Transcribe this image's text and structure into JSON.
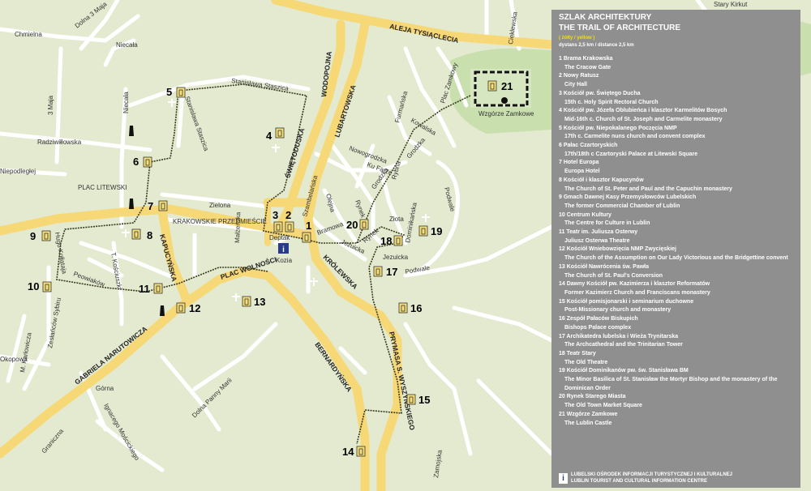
{
  "map": {
    "streets": {
      "aleja_tysiaclecia": "ALEJA TYSIĄCLECIA",
      "dolna_3_maja": "Dolna 3 Maja",
      "chmielna": "Chmielna",
      "niecala": "Niecała",
      "niecala_2": "Niecała",
      "ulica_3_maja": "3 Maja",
      "stanislawa_staszica": "Stanisława Staszica",
      "stanislawa_staszica_2": "Stanisława Staszica",
      "radziwillowska": "Radziwiłłowska",
      "niepodleglej": "Niepodległej",
      "plac_litewski": "PLAC LITEWSKI",
      "zielona": "Zielona",
      "krakowskie": "KRAKOWSKIE PRZEDMIEŚCIE",
      "hugo_kollataja": "Hugo Kołłątaja",
      "kapucynska": "KAPUCYŃSKA",
      "t_kosciuszki": "T. Kościuszki",
      "peowiakow": "Peowiaków",
      "zielinskiego_sybiru": "Zesłańców Sybiru",
      "m_karlowicza": "M. Karłowicza",
      "okopowa": "Okopowa",
      "gabriela_narutowicza": "GABRIELA NARUTOWICZA",
      "plac_wolnosci": "PLAC WOLNOŚCI",
      "bernardynska": "BERNARDYŃSKA",
      "gorna": "Górna",
      "dolna_panny_marii": "Dolna Panny Marii",
      "ignacego_moscickiego": "Ignacego Mościckiego",
      "graniczna": "Graniczna",
      "zamojska": "Zamojska",
      "prymasa": "PRYMASA S. WYSZYŃSKIEGO",
      "krolewska": "KRÓLEWSKA",
      "podwale": "Podwale",
      "podwale_2": "Podwale",
      "jezuicka": "Jezuicka",
      "jezuicka_2": "Jezuicka",
      "zlota": "Złota",
      "dominikanska": "Dominikańska",
      "rynek": "Rynek",
      "rynek_2": "Rynek",
      "bramowa": "Bramowa",
      "olejna": "Olejna",
      "swietoduska": "ŚWIĘTODUSKA",
      "lubartowska": "LUBARTOWSKA",
      "wodopojna": "WODOPOJNA",
      "nowogrodzka": "Nowogrodzka",
      "grodzka": "Grodzka",
      "grodzka_2": "Grodzka",
      "ku_farze": "Ku Farze",
      "rybna": "Rybna",
      "furmanska": "Furmańska",
      "plac_zamkowy": "Plac Zamkowy",
      "kowalska": "Kowalska",
      "cieklewska": "Cieklewska",
      "stary_kirkut": "Stary Kirkut",
      "deptak": "Deptak",
      "kozia": "Kozia",
      "samborska": "Sambrowska",
      "wzgorze": "Wzgórze Zamkowe",
      "malzonka": "Małżeńska",
      "szambelanska": "Szambelańska"
    },
    "stops": [
      "1",
      "2",
      "3",
      "4",
      "5",
      "6",
      "7",
      "8",
      "9",
      "10",
      "11",
      "12",
      "13",
      "14",
      "15",
      "16",
      "17",
      "18",
      "19",
      "20",
      "21"
    ],
    "info_glyph": "i",
    "colors": {
      "background": "#e3ead0",
      "major_road": "#f7d877",
      "minor_road": "#ffffff",
      "route": "#3a3a1a",
      "park": "#c9dfae",
      "panel": "#8f8f8f",
      "accent": "#f6e000"
    }
  },
  "legend": {
    "title": "SZLAK ARCHITEKTURY",
    "subtitle": "THE TRAIL OF ARCHITECTURE",
    "color_note": "( żółty / yellow )",
    "distance": "dystans 2,5 km / distance 2,5 km",
    "items": [
      {
        "num": "1",
        "pl": "Brama Krakowska",
        "en": "The Cracow Gate"
      },
      {
        "num": "2",
        "pl": "Nowy Ratusz",
        "en": "City Hall"
      },
      {
        "num": "3",
        "pl": "Kościół pw. Świętego Ducha",
        "en": "15th c. Holy Spirit Rectoral Church"
      },
      {
        "num": "4",
        "pl": "Kościół pw. Józefa Oblubieńca i klasztor Karmelitów Bosych",
        "en": "Mid-16th c. Church of St. Joseph and Carmelite monastery"
      },
      {
        "num": "5",
        "pl": "Kościół pw. Niepokalanego Poczęcia NMP",
        "en": "17th c. Carmelite nuns church and convent complex"
      },
      {
        "num": "6",
        "pl": "Pałac Czartoryskich",
        "en": "17th/18th c Czartoryski Palace at Litewski Square"
      },
      {
        "num": "7",
        "pl": "Hotel Europa",
        "en": "Europa Hotel"
      },
      {
        "num": "8",
        "pl": "Kościół i klasztor Kapucynów",
        "en": "The Church of St. Peter and Paul and the Capuchin monastery"
      },
      {
        "num": "9",
        "pl": "Gmach Dawnej Kasy Przemysłowców Lubelskich",
        "en": "The former Commercial Chamber of Lublin"
      },
      {
        "num": "10",
        "pl": "Centrum Kultury",
        "en": "The Centre for Culture in Lublin"
      },
      {
        "num": "11",
        "pl": "Teatr im. Juliusza Osterwy",
        "en": "Juliusz Osterwa Theatre"
      },
      {
        "num": "12",
        "pl": "Kościół Wniebowzięcia NMP Zwycięskiej",
        "en": "The Church of the Assumption on Our Lady Victorious and the Bridgettine convent"
      },
      {
        "num": "13",
        "pl": "Kościół Nawrócenia św. Pawła",
        "en": "The Church of St. Paul's Conversion"
      },
      {
        "num": "14",
        "pl": "Dawny Kościół pw. Kazimierza i klasztor Reformatów",
        "en": "Former Kazimierz Church and Franciscans monastery"
      },
      {
        "num": "15",
        "pl": "Kościół pomisjonarski i seminarium duchowne",
        "en": "Post-Missionary church and monastery"
      },
      {
        "num": "16",
        "pl": "Zespół Pałaców Biskupich",
        "en": "Bishops Palace complex"
      },
      {
        "num": "17",
        "pl": "Archikatedra lubelska i Wieża Trynitarska",
        "en": "The Archcathedral and the Trinitarian Tower"
      },
      {
        "num": "18",
        "pl": "Teatr Stary",
        "en": "The Old Theatre"
      },
      {
        "num": "19",
        "pl": "Kościół Dominikanów pw. św. Stanisława BM",
        "en": "The Minor Basilica of St. Stanisław the Mortyr Bishop and the monastery of the Dominican Order"
      },
      {
        "num": "20",
        "pl": "Rynek Starego Miasta",
        "en": "The Old Town Market Square"
      },
      {
        "num": "21",
        "pl": "Wzgórze Zamkowe",
        "en": "The Lublin Castle"
      }
    ],
    "footer_pl": "LUBELSKI OŚRODEK INFORMACJI TURYSTYCZNEJ I KULTURALNEJ",
    "footer_en": "LUBLIN TOURIST AND CULTURAL INFORMATION CENTRE",
    "footer_icon": "i"
  }
}
